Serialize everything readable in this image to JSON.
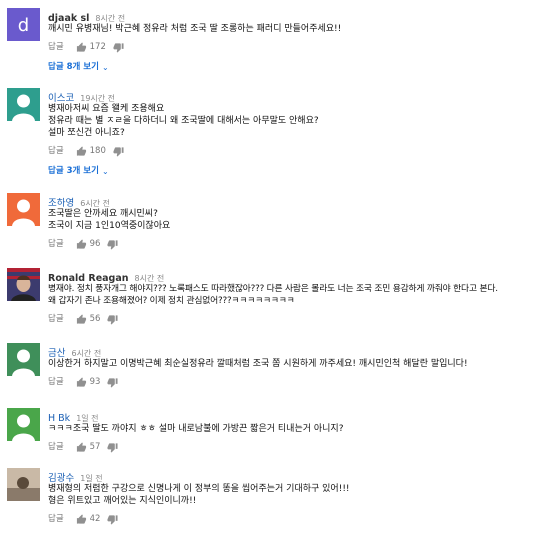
{
  "comments": [
    {
      "author": "djaak sl",
      "time": "8시간 전",
      "lines": [
        "깨시민 유병재님! 박근혜 정유라 처럼 조국 딸 조롱하는 패러디 만들어주세요!!"
      ],
      "reply_label": "답글",
      "likes": "172",
      "view_replies": "답글 8개 보기",
      "avatar_color": "#6a5acd",
      "avatar_letter": "d"
    },
    {
      "author": "이스코",
      "time": "19시간 전",
      "lines": [
        "병재아저씨 요즘 왤케 조용해요",
        "정유라 때는 별 ㅈㄹ을 다하더니 왜 조국딸에 대해서는 아무말도 안해요?",
        "설마 쪼신건 아니죠?"
      ],
      "reply_label": "답글",
      "likes": "180",
      "view_replies": "답글 3개 보기",
      "avatar_color": "#2e9e8e",
      "avatar_letter": ""
    },
    {
      "author": "조하영",
      "time": "6시간 전",
      "lines": [
        "조국딸은 안까세요 깨시민씨?",
        "조국이 지금 1인10역중이잖아요"
      ],
      "reply_label": "답글",
      "likes": "96",
      "avatar_color": "#f06a3a",
      "avatar_letter": ""
    },
    {
      "author": "Ronald Reagan",
      "time": "8시간 전",
      "lines": [
        "병재야. 정치 풍자개그 해야지??? 노록패스도 따라했잖아??? 다른 사람은 몰라도 너는 조국 조민 용감하게 까줘야 한다고 본다.",
        "왜 갑자기 존나 조용해졌어? 이제 정치 관심없어???ㅋㅋㅋㅋㅋㅋㅋㅋ"
      ],
      "reply_label": "답글",
      "likes": "56",
      "avatar_color": "#b22234",
      "avatar_letter": ""
    },
    {
      "author": "금산",
      "time": "6시간 전",
      "lines": [
        "이상한거 하지말고 이명박근혜 최순실정유라 깔때처럼 조국 쫌 시원하게 까주세요! 깨시민인척 해달란 말입니다!"
      ],
      "reply_label": "답글",
      "likes": "93",
      "avatar_color": "#3f8f5a",
      "avatar_letter": ""
    },
    {
      "author": "H Bk",
      "time": "1일 전",
      "lines": [
        "ㅋㅋㅋ조국 딸도 까야지 ㅎㅎ 설마 내로남불에 가방끈 짧은거 티내는거 아니지?"
      ],
      "reply_label": "답글",
      "likes": "57",
      "avatar_color": "#4aa64a",
      "avatar_letter": ""
    },
    {
      "author": "김광수",
      "time": "1일 전",
      "lines": [
        "병재형의 저렴한 구강으로 신명나게 이 정부의 똥을 씹어주는거 기대하구 있어!!!",
        "형은 위트있고 깨어있는 지식인이니까!!"
      ],
      "reply_label": "답글",
      "likes": "42",
      "avatar_color": "#8a7a6a",
      "avatar_letter": ""
    }
  ]
}
